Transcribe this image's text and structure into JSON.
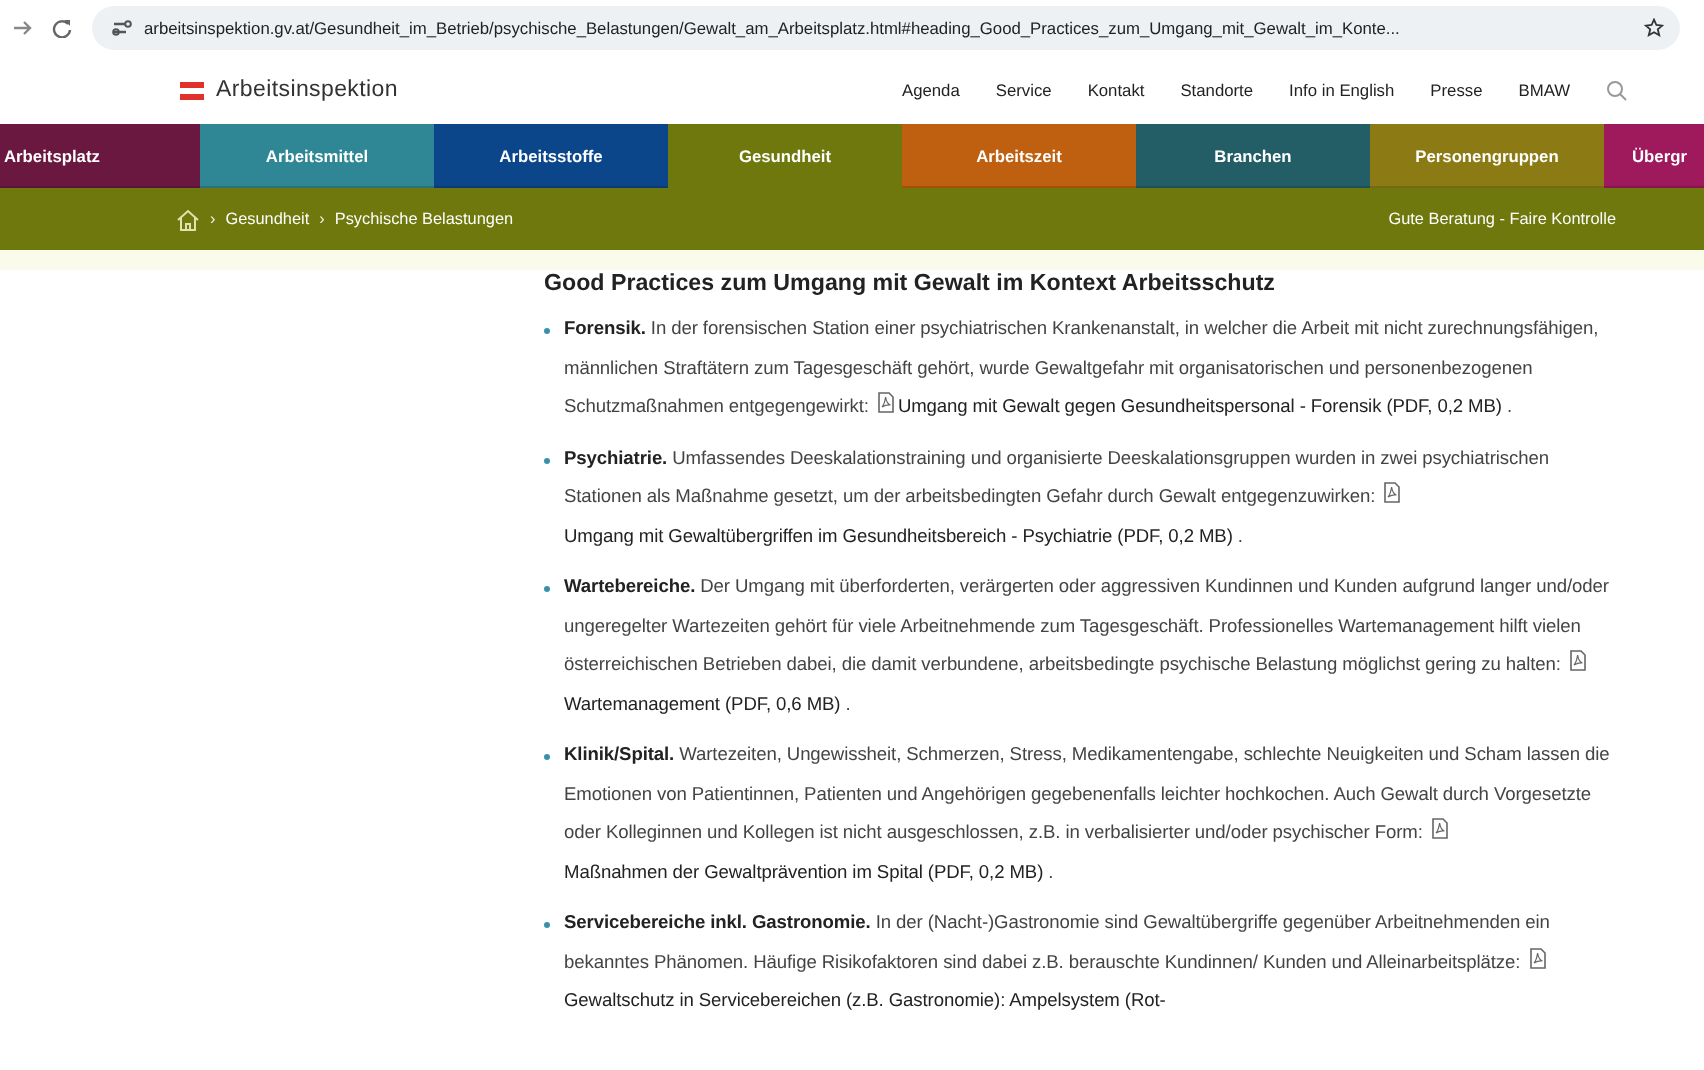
{
  "browser": {
    "url": "arbeitsinspektion.gv.at/Gesundheit_im_Betrieb/psychische_Belastungen/Gewalt_am_Arbeitsplatz.html#heading_Good_Practices_zum_Umgang_mit_Gewalt_im_Konte..."
  },
  "header": {
    "logo": "Arbeitsinspektion",
    "nav": [
      "Agenda",
      "Service",
      "Kontakt",
      "Standorte",
      "Info in English",
      "Presse",
      "BMAW"
    ]
  },
  "categories": [
    {
      "label": "Arbeitsplatz",
      "color": "#6b1840",
      "selected": false
    },
    {
      "label": "Arbeitsmittel",
      "color": "#2f8795",
      "selected": false
    },
    {
      "label": "Arbeitsstoffe",
      "color": "#0c468a",
      "selected": false
    },
    {
      "label": "Gesundheit",
      "color": "#6e780c",
      "selected": true
    },
    {
      "label": "Arbeitszeit",
      "color": "#be600f",
      "selected": false
    },
    {
      "label": "Branchen",
      "color": "#235d66",
      "selected": false
    },
    {
      "label": "Personengruppen",
      "color": "#8c7b14",
      "selected": false
    },
    {
      "label": "Übergr",
      "color": "#9e1a5c",
      "selected": false
    }
  ],
  "breadcrumb": {
    "separator": "›",
    "items": [
      "Gesundheit",
      "Psychische Belastungen"
    ],
    "tagline": "Gute Beratung - Faire Kontrolle"
  },
  "article": {
    "heading": "Good Practices zum Umgang mit Gewalt im Kontext Arbeitsschutz",
    "items": [
      {
        "lead": "Forensik.",
        "text": "In der forensischen Station einer psychiatrischen Krankenanstalt, in welcher die Arbeit mit nicht zurechnungsfähigen, männlichen Straftätern zum Tagesgeschäft gehört, wurde Gewaltgefahr mit organisatorischen und personenbezogenen Schutzmaßnahmen entgegengewirkt:",
        "link": "Umgang mit Gewalt gegen Gesundheitspersonal - Forensik",
        "size": "(PDF, 0,2 MB)",
        "end": "."
      },
      {
        "lead": "Psychiatrie.",
        "text": "Umfassendes Deeskalationstraining und organisierte Deeskalationsgruppen wurden in zwei psychiatrischen Stationen als Maßnahme gesetzt, um der arbeitsbedingten Gefahr durch Gewalt entgegenzuwirken:",
        "link": "Umgang mit Gewaltübergriffen im Gesundheitsbereich - Psychiatrie",
        "size": "(PDF, 0,2 MB)",
        "end": "."
      },
      {
        "lead": "Wartebereiche.",
        "text": "Der Umgang mit überforderten, verärgerten oder aggressiven Kundinnen und Kunden aufgrund langer und/oder ungeregelter Wartezeiten gehört für viele Arbeitnehmende zum Tagesgeschäft. Professionelles Wartemanagement hilft vielen österreichischen Betrieben dabei, die damit verbundene, arbeitsbedingte psychische Belastung möglichst gering zu halten:",
        "link": "Wartemanagement",
        "size": "(PDF, 0,6 MB)",
        "end": "."
      },
      {
        "lead": "Klinik/Spital.",
        "text": "Wartezeiten, Ungewissheit, Schmerzen, Stress, Medikamentengabe, schlechte Neuigkeiten und Scham lassen die Emotionen von Patientinnen, Patienten und Angehörigen gegebenenfalls leichter hochkochen. Auch Gewalt durch Vorgesetzte oder Kolleginnen und Kollegen ist nicht ausgeschlossen, z.B. in verbalisierter und/oder psychischer Form:",
        "link": "Maßnahmen der Gewaltprävention im Spital",
        "size": "(PDF, 0,2 MB)",
        "end": "."
      },
      {
        "lead": "Servicebereiche inkl. Gastronomie.",
        "text": "In der (Nacht-)Gastronomie sind Gewaltübergriffe gegenüber Arbeitnehmenden ein bekanntes Phänomen. Häufige Risikofaktoren sind dabei z.B. berauschte Kundinnen/ Kunden und Alleinarbeitsplätze:",
        "link": "Gewaltschutz in Servicebereichen (z.B. Gastronomie): Ampelsystem (Rot-"
      }
    ]
  }
}
